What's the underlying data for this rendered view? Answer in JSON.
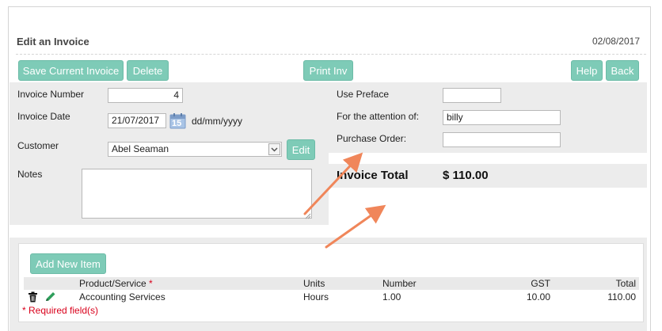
{
  "header": {
    "title": "Edit an Invoice",
    "date": "02/08/2017"
  },
  "toolbar": {
    "save_label": "Save Current Invoice",
    "delete_label": "Delete",
    "print_label": "Print Inv",
    "help_label": "Help",
    "back_label": "Back"
  },
  "form": {
    "invoice_number_label": "Invoice Number",
    "invoice_number_value": "4",
    "invoice_date_label": "Invoice Date",
    "invoice_date_value": "21/07/2017",
    "date_format": "dd/mm/yyyy",
    "calendar_day": "15",
    "customer_label": "Customer",
    "customer_value": "Abel Seaman",
    "edit_label": "Edit",
    "notes_label": "Notes",
    "notes_value": "",
    "use_preface_label": "Use Preface",
    "use_preface_value": "",
    "attention_label": "For the attention of:",
    "attention_value": "billy",
    "purchase_order_label": "Purchase Order:",
    "purchase_order_value": ""
  },
  "total": {
    "label": "Invoice Total",
    "value": "$ 110.00"
  },
  "items": {
    "add_label": "Add New Item",
    "columns": {
      "product": "Product/Service",
      "units": "Units",
      "number": "Number",
      "gst": "GST",
      "total": "Total"
    },
    "required_mark": "*",
    "rows": [
      {
        "product": "Accounting Services",
        "units": "Hours",
        "number": "1.00",
        "gst": "10.00",
        "total": "110.00"
      }
    ],
    "required_note": "* Required field(s)"
  },
  "colors": {
    "button": "#7ecbb7",
    "panel": "#ececec",
    "arrow": "#f0865a",
    "required": "#d9001b"
  },
  "icons": [
    "calendar-icon",
    "dropdown-arrow-icon",
    "trash-icon",
    "pencil-icon",
    "resize-grip-icon"
  ]
}
